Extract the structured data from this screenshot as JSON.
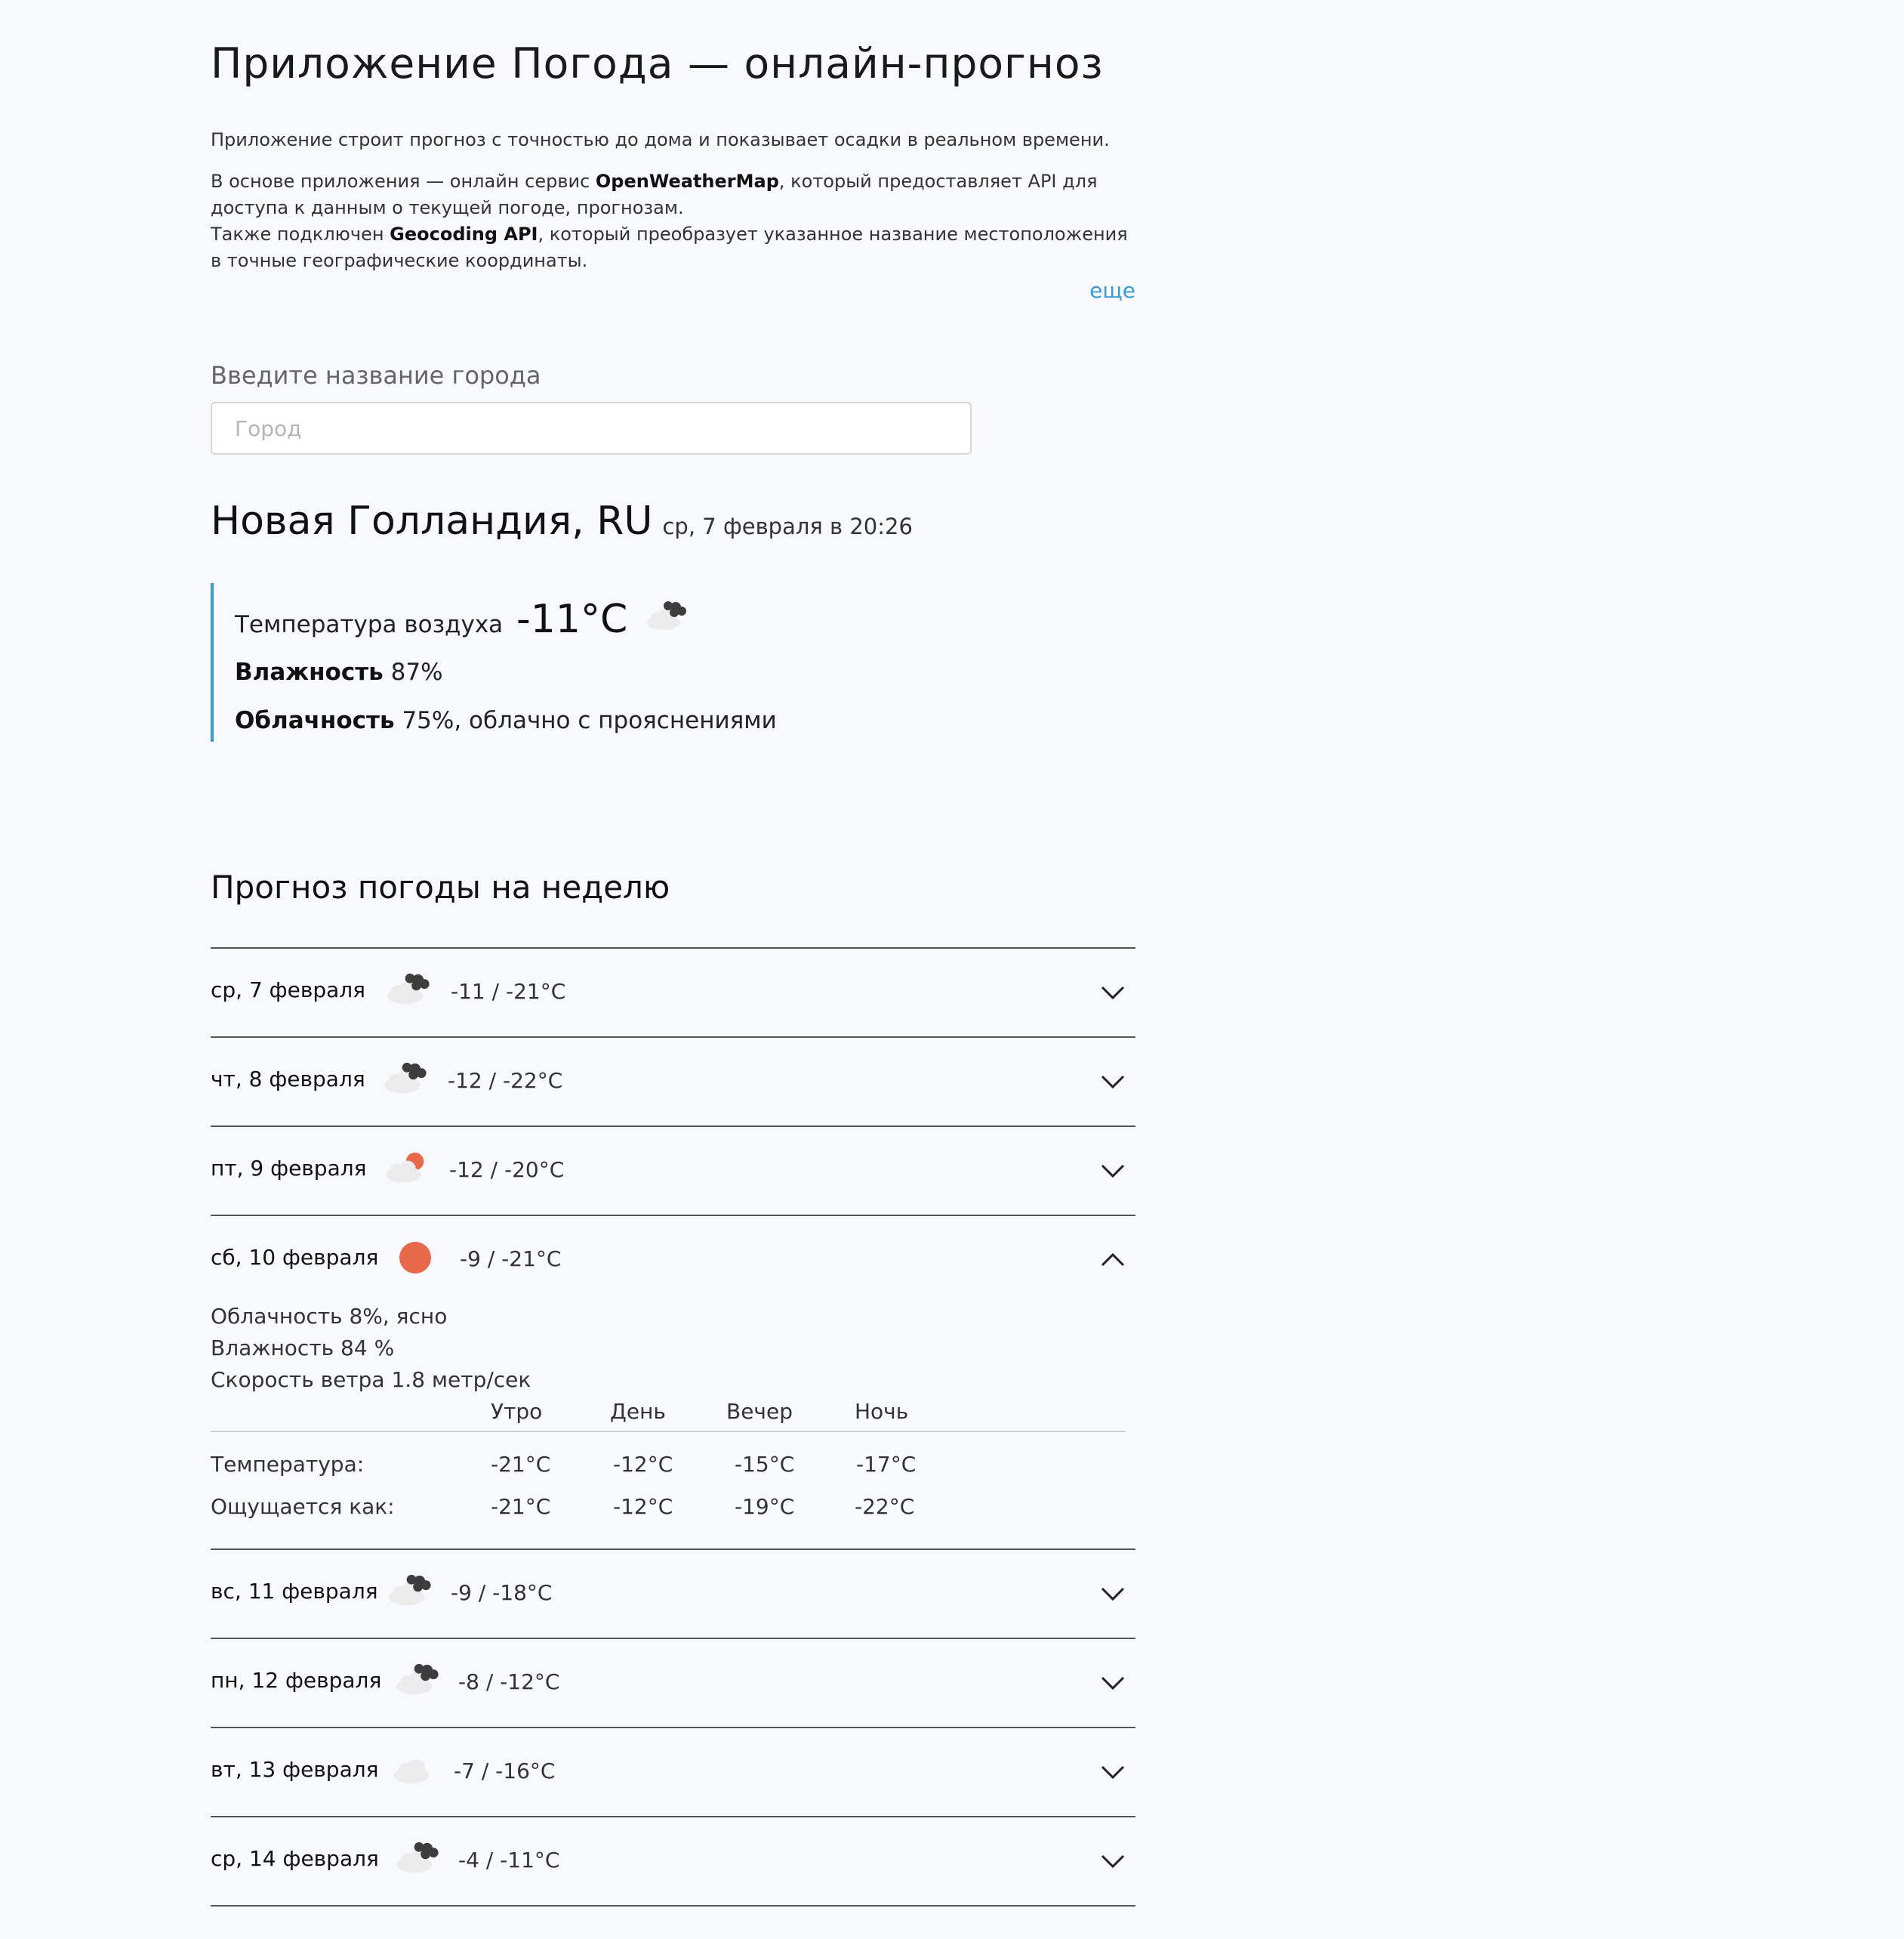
{
  "header": {
    "title": "Приложение Погода — онлайн-прогноз",
    "p1": "Приложение строит прогноз с точностью до дома и показывает осадки в реальном времени.",
    "p2_a": "В основе приложения — онлайн сервис ",
    "p2_b": "OpenWeatherMap",
    "p2_c": ", который предоставляет API для доступа к данным о текущей погоде, прогнозам.",
    "p3_a": "Также подключен ",
    "p3_b": "Geocoding API",
    "p3_c": ", который преобразует указанное название местоположения в точные географические координаты.",
    "more_label": "еще"
  },
  "search": {
    "label": "Введите название города",
    "placeholder": "Город",
    "value": ""
  },
  "current": {
    "city": "Новая Голландия, RU",
    "datetime": "ср, 7 февраля в 20:26",
    "temp_label": "Температура воздуха",
    "temp_value": "-11°C",
    "icon": "cloudy-icon",
    "humidity_label": "Влажность",
    "humidity_value": "87%",
    "cloud_label": "Облачность",
    "cloud_value": "75%, облачно с прояснениями"
  },
  "week": {
    "title": "Прогноз погоды на неделю",
    "days": [
      {
        "date": "ср, 7 февраля",
        "icon": "cloudy-icon",
        "temps": "-11 / -21°C",
        "expanded": false
      },
      {
        "date": "чт, 8 февраля",
        "icon": "cloudy-icon",
        "temps": "-12 / -22°C",
        "expanded": false
      },
      {
        "date": "пт, 9 февраля",
        "icon": "partly-sunny-icon",
        "temps": "-12 / -20°C",
        "expanded": false
      },
      {
        "date": "сб, 10 февраля",
        "icon": "sun-icon",
        "temps": "-9 / -21°C",
        "expanded": true
      },
      {
        "date": "вс, 11 февраля",
        "icon": "cloudy-icon",
        "temps": "-9 / -18°C",
        "expanded": false
      },
      {
        "date": "пн, 12 февраля",
        "icon": "cloudy-icon",
        "temps": "-8 / -12°C",
        "expanded": false
      },
      {
        "date": "вт, 13 февраля",
        "icon": "light-cloud-icon",
        "temps": "-7 / -16°C",
        "expanded": false
      },
      {
        "date": "ср, 14 февраля",
        "icon": "cloudy-icon",
        "temps": "-4 / -11°C",
        "expanded": false
      }
    ],
    "details": {
      "cloudiness": "Облачность 8%, ясно",
      "humidity": "Влажность 84 %",
      "wind": "Скорость ветра 1.8 метр/сек",
      "columns": [
        "Утро",
        "День",
        "Вечер",
        "Ночь"
      ],
      "temp_label": "Температура:",
      "temp_values": [
        "-21°C",
        "-12°C",
        "-15°C",
        "-17°C"
      ],
      "feels_label": "Ощущается как:",
      "feels_values": [
        "-21°C",
        "-12°C",
        "-19°C",
        "-22°C"
      ]
    }
  },
  "colors": {
    "accent": "#3a9bd9",
    "sun": "#e8694a",
    "background": "#f8f9fd"
  }
}
